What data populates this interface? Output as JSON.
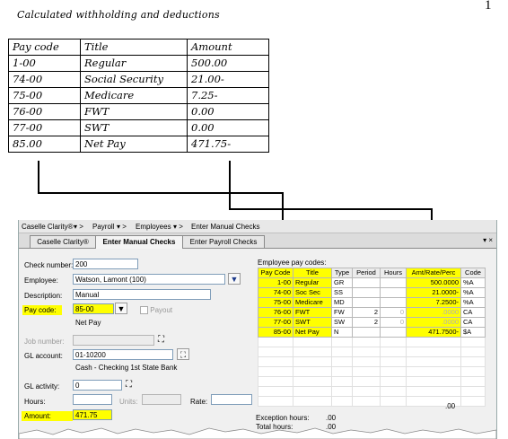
{
  "page_number": "1",
  "handwritten": {
    "title": "Calculated withholding and deductions",
    "columns": [
      "Pay code",
      "Title",
      "Amount"
    ],
    "rows": [
      [
        "1-00",
        "Regular",
        "500.00"
      ],
      [
        "74-00",
        "Social Security",
        "21.00-"
      ],
      [
        "75-00",
        "Medicare",
        "7.25-"
      ],
      [
        "76-00",
        "FWT",
        "0.00"
      ],
      [
        "77-00",
        "SWT",
        "0.00"
      ],
      [
        "85.00",
        "Net Pay",
        "471.75-"
      ]
    ]
  },
  "app": {
    "breadcrumb": [
      "Caselle Clarity®",
      "Payroll",
      "Employees",
      "Enter Manual Checks"
    ],
    "tabs": [
      "Caselle Clarity®",
      "Enter Manual Checks",
      "Enter Payroll Checks"
    ],
    "tab_controls": "▾ ×",
    "form": {
      "check_number_label": "Check number:",
      "check_number_value": "200",
      "employee_label": "Employee:",
      "employee_value": "Watson, Lamont  (100)",
      "description_label": "Description:",
      "description_value": "Manual",
      "pay_code_label": "Pay code:",
      "pay_code_value": "85-00",
      "payout_label": "Payout",
      "pay_code_desc": "Net Pay",
      "job_number_label": "Job number:",
      "job_number_value": "",
      "gl_account_label": "GL account:",
      "gl_account_value": "01-10200",
      "gl_account_desc": "Cash - Checking 1st State Bank",
      "gl_activity_label": "GL activity:",
      "gl_activity_value": "0",
      "hours_label": "Hours:",
      "units_label": "Units:",
      "rate_label": "Rate:",
      "amount_label": "Amount:",
      "amount_value": "471.75"
    },
    "grid": {
      "title": "Employee pay codes:",
      "columns": [
        "Pay Code",
        "Title",
        "Type",
        "Period",
        "Hours",
        "Amt/Rate/Perc",
        "Code"
      ],
      "rows": [
        [
          "1-00",
          "Regular",
          "GR",
          "",
          "",
          "500.0000",
          "%A"
        ],
        [
          "74-00",
          "Soc Sec",
          "SS",
          "",
          "",
          "21.0000-",
          "%A"
        ],
        [
          "75-00",
          "Medicare",
          "MD",
          "",
          "",
          "7.2500-",
          "%A"
        ],
        [
          "76-00",
          "FWT",
          "FW",
          "2",
          "0",
          ".0000",
          "CA"
        ],
        [
          "77-00",
          "SWT",
          "SW",
          "2",
          "0",
          ".0000",
          "CA"
        ],
        [
          "85-00",
          "Net Pay",
          "N",
          "",
          "",
          "471.7500-",
          "$A"
        ]
      ],
      "footer_value": ".00"
    },
    "exception_hours_label": "Exception hours:",
    "exception_hours_value": ".00",
    "total_hours_label": "Total hours:",
    "total_hours_value": ".00"
  },
  "colors": {
    "highlight": "#ffff00",
    "window_bg": "#f0f0f0"
  }
}
